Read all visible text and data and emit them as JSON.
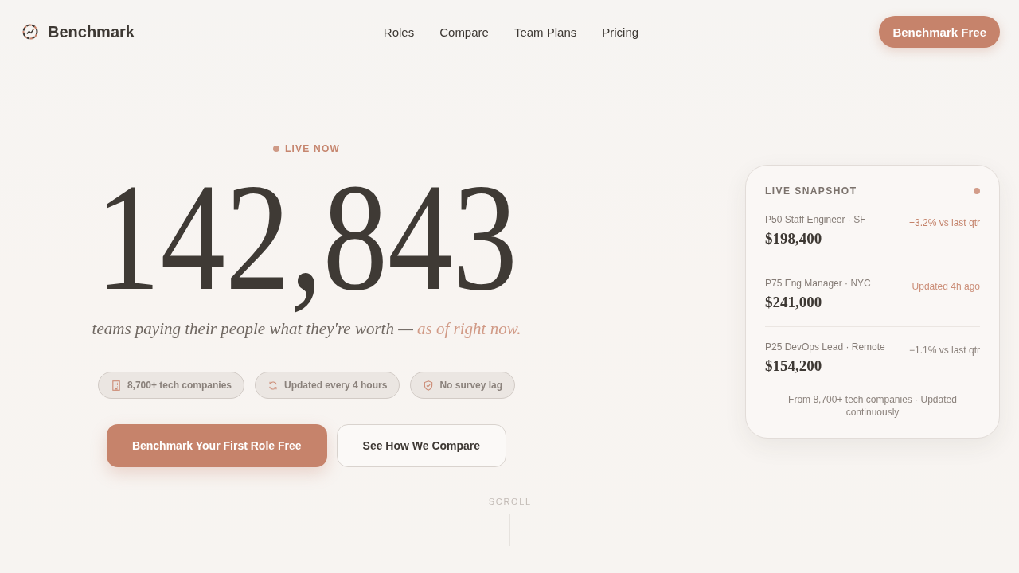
{
  "header": {
    "logo": "Benchmark",
    "nav": [
      "Roles",
      "Compare",
      "Team Plans",
      "Pricing"
    ],
    "cta": "Benchmark Free"
  },
  "hero": {
    "badge": "LIVE NOW",
    "count": "142,843",
    "tagline": {
      "text": "teams paying their people what they're worth —",
      "accent": "as of right now."
    },
    "chips": [
      "8,700+ tech companies",
      "Updated every 4 hours",
      "No survey lag"
    ],
    "buttons": [
      {
        "kind": "primary",
        "label": "Benchmark Your First Role Free"
      },
      {
        "kind": "secondary",
        "label": "See How We Compare"
      }
    ]
  },
  "snapshot": {
    "title": "LIVE SNAPSHOT",
    "rows": [
      {
        "role": "P50 Staff Engineer · SF",
        "salary": "$198,400",
        "note": "+3.2% vs last qtr",
        "color": "#c4836b"
      },
      {
        "role": "P75 Eng Manager · NYC",
        "salary": "$241,000",
        "note": "Updated 4h ago",
        "color": "#cb8e78"
      },
      {
        "role": "P25 DevOps Lead · Remote",
        "salary": "$154,200",
        "note": "−1.1% vs last qtr",
        "color": "#8a817b"
      }
    ],
    "footnote": "From 8,700+ tech companies · Updated continuously"
  },
  "scroll": {
    "label": "SCROLL"
  }
}
